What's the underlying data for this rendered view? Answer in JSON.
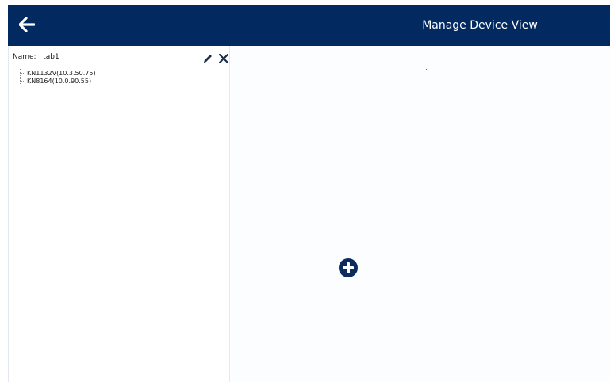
{
  "header": {
    "title": "Manage Device View",
    "back_icon": "arrow-left-icon",
    "background_color": "#022a60"
  },
  "left_panel": {
    "name_label": "Name:",
    "name_value": "tab1",
    "edit_icon": "pencil-icon",
    "close_icon": "close-icon",
    "devices": [
      "KN1132V(10.3.50.75)",
      "KN8164(10.0.90.55)"
    ]
  },
  "main": {
    "add_icon": "plus-circle-icon",
    "accent_color": "#0b2c5c"
  }
}
